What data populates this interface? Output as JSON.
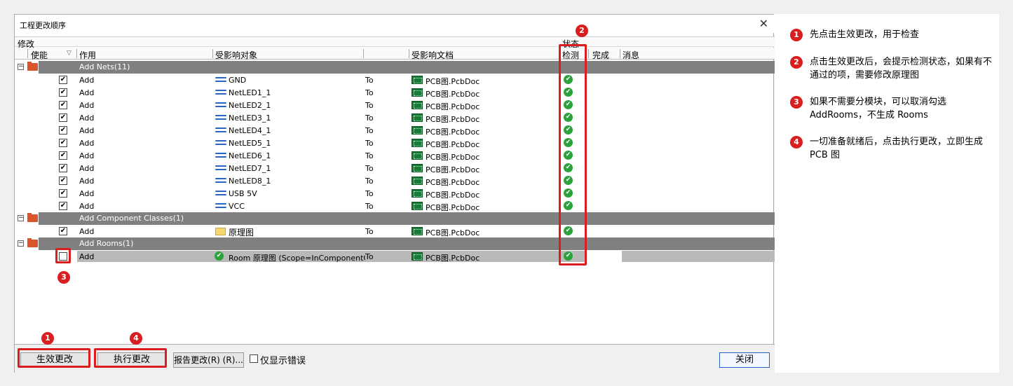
{
  "dialog": {
    "title": "工程更改顺序",
    "close_glyph": "✕",
    "group_modify": "修改",
    "group_status": "状态"
  },
  "columns": {
    "enable": "使能",
    "action": "作用",
    "affected_object": "受影响对象",
    "affected_doc": "受影响文档",
    "check": "检测",
    "done": "完成",
    "message": "消息"
  },
  "categories": [
    {
      "label": "Add Nets(11)",
      "rows": [
        {
          "action": "Add",
          "object": "GND",
          "to": "To",
          "doc": "PCB图.PcbDoc",
          "checked": true
        },
        {
          "action": "Add",
          "object": "NetLED1_1",
          "to": "To",
          "doc": "PCB图.PcbDoc",
          "checked": true
        },
        {
          "action": "Add",
          "object": "NetLED2_1",
          "to": "To",
          "doc": "PCB图.PcbDoc",
          "checked": true
        },
        {
          "action": "Add",
          "object": "NetLED3_1",
          "to": "To",
          "doc": "PCB图.PcbDoc",
          "checked": true
        },
        {
          "action": "Add",
          "object": "NetLED4_1",
          "to": "To",
          "doc": "PCB图.PcbDoc",
          "checked": true
        },
        {
          "action": "Add",
          "object": "NetLED5_1",
          "to": "To",
          "doc": "PCB图.PcbDoc",
          "checked": true
        },
        {
          "action": "Add",
          "object": "NetLED6_1",
          "to": "To",
          "doc": "PCB图.PcbDoc",
          "checked": true
        },
        {
          "action": "Add",
          "object": "NetLED7_1",
          "to": "To",
          "doc": "PCB图.PcbDoc",
          "checked": true
        },
        {
          "action": "Add",
          "object": "NetLED8_1",
          "to": "To",
          "doc": "PCB图.PcbDoc",
          "checked": true
        },
        {
          "action": "Add",
          "object": "USB 5V",
          "to": "To",
          "doc": "PCB图.PcbDoc",
          "checked": true
        },
        {
          "action": "Add",
          "object": "VCC",
          "to": "To",
          "doc": "PCB图.PcbDoc",
          "checked": true
        }
      ]
    },
    {
      "label": "Add Component Classes(1)",
      "rows": [
        {
          "action": "Add",
          "object": "原理图",
          "to": "To",
          "doc": "PCB图.PcbDoc",
          "checked": true
        }
      ]
    },
    {
      "label": "Add Rooms(1)",
      "rows": [
        {
          "action": "Add",
          "object": "Room 原理图 (Scope=InComponentC",
          "to": "To",
          "doc": "PCB图.PcbDoc",
          "checked": false
        }
      ]
    }
  ],
  "footer": {
    "validate_button": "生效更改",
    "execute_button": "执行更改",
    "report_button": "报告更改(R) (R)...",
    "only_errors_label": "仅显示错误",
    "close_button": "关闭"
  },
  "icons": {
    "net": "net-icon",
    "pcb_doc": "pcb-doc-icon",
    "check_ok": "check-ok-icon",
    "folder": "folder-icon"
  },
  "colors": {
    "highlight": "#d81e1e",
    "category_bar": "#808080",
    "ok_green": "#2aa33a",
    "selected_row": "#b9b9b9"
  },
  "callouts": [
    "1",
    "2",
    "3",
    "4"
  ],
  "notes": [
    {
      "num": "1",
      "text": "先点击生效更改，用于检查"
    },
    {
      "num": "2",
      "text": "点击生效更改后，会提示检测状态，如果有不通过的项，需要修改原理图"
    },
    {
      "num": "3",
      "text": "如果不需要分模块，可以取消勾选AddRooms，不生成 Rooms"
    },
    {
      "num": "4",
      "text": "一切准备就绪后，点击执行更改，立即生成 PCB 图"
    }
  ]
}
